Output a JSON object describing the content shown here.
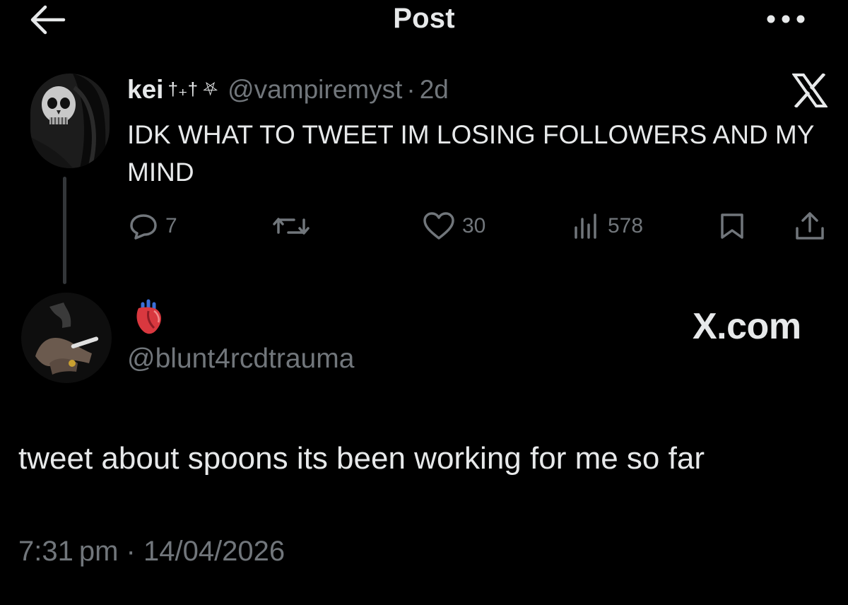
{
  "header": {
    "title": "Post",
    "back_icon": "arrow-left-icon",
    "more_icon": "more-horizontal-icon"
  },
  "original_post": {
    "author_name": "kei",
    "author_decoration": "†₊† ⛧",
    "handle": "@vampiremyst",
    "separator": "·",
    "time_ago": "2d",
    "text": "IDK WHAT TO TWEET IM LOSING FOLLOWERS AND MY MIND",
    "platform_icon": "x-logo-icon",
    "actions": {
      "replies": "7",
      "reposts": "",
      "likes": "30",
      "views": "578"
    }
  },
  "reply_post": {
    "display_name_emoji": "anatomical-heart-icon",
    "handle": "@blunt4rcdtrauma",
    "watermark": "X.com",
    "text": "tweet about spoons its been working for me so far",
    "timestamp": "7:31 pm · 14/04/2026"
  },
  "colors": {
    "background": "#000000",
    "primary_text": "#e7e9ea",
    "secondary_text": "#71767b",
    "thread_line": "#333639"
  }
}
